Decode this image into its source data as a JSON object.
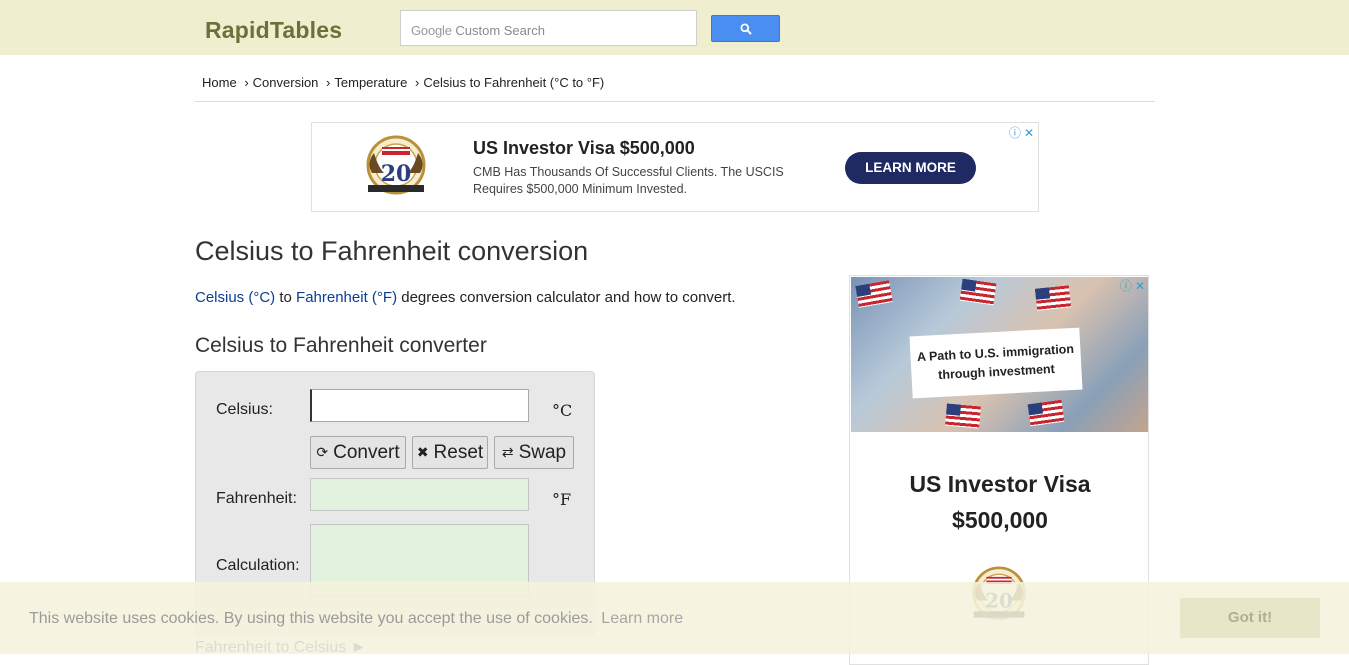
{
  "header": {
    "logo": "RapidTables",
    "search": {
      "google_label": "Google",
      "placeholder": "Custom Search",
      "button_icon": "search-icon"
    }
  },
  "breadcrumb": {
    "items": [
      "Home",
      "Conversion",
      "Temperature",
      "Celsius to Fahrenheit (°C to °F)"
    ],
    "separator": "›"
  },
  "ad_top": {
    "title": "US Investor Visa $500,000",
    "body": "CMB Has Thousands Of Successful Clients. The USCIS Requires $500,000 Minimum Invested.",
    "button": "LEARN MORE",
    "seal_number": "20"
  },
  "main": {
    "title": "Celsius to Fahrenheit conversion",
    "intro": {
      "link1": "Celsius (°C)",
      "mid": " to ",
      "link2": "Fahrenheit (°F)",
      "rest": " degrees conversion calculator and how to convert."
    },
    "converter_title": "Celsius to Fahrenheit converter",
    "calculator": {
      "celsius_label": "Celsius:",
      "celsius_unit": "°C",
      "celsius_value": "",
      "convert_label": "Convert",
      "reset_label": "Reset",
      "swap_label": "Swap",
      "fahrenheit_label": "Fahrenheit:",
      "fahrenheit_unit": "°F",
      "fahrenheit_value": "",
      "calculation_label": "Calculation:",
      "calculation_value": ""
    },
    "next_link": "Fahrenheit to Celsius ►"
  },
  "ad_right": {
    "banner_text": "A Path to U.S. immigration through investment",
    "title_line1": "US Investor Visa",
    "title_line2": "$500,000",
    "seal_number": "20"
  },
  "cookie": {
    "text": "This website uses cookies. By using this website you accept the use of cookies.",
    "learn_more": "Learn more",
    "button": "Got it!"
  },
  "colors": {
    "header_bg": "#efefcf",
    "link": "#0b3d91",
    "search_button": "#4b8ef1",
    "ad_button": "#1f2a63",
    "calc_panel": "#e8e8e8",
    "output_bg": "#e3f1df"
  }
}
